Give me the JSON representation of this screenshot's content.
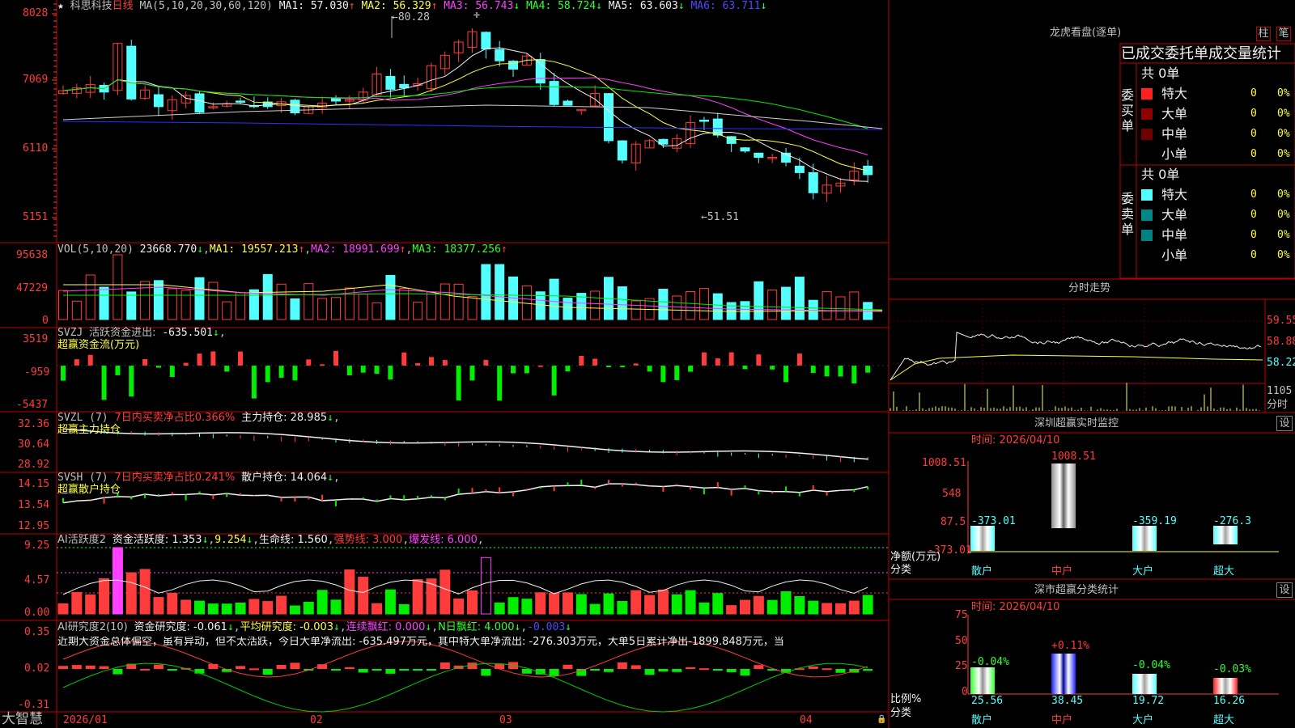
{
  "stock": {
    "name": "科思科技",
    "period": "日线",
    "ma_params": "MA(5,10,20,30,60,120)",
    "ma1": "MA1: 57.030",
    "ma2": "MA2: 56.329",
    "ma3": "MA3: 56.743",
    "ma4": "MA4: 58.724",
    "ma5": "MA5: 63.603",
    "ma6": "MA6: 63.711",
    "arrow_up": "↑",
    "arrow_down": "↓",
    "star": "★",
    "plus": "✛",
    "high_label": "80.28",
    "low_label": "51.51",
    "high_arrow": "←",
    "low_arrow": "←"
  },
  "price_axis": [
    "8028",
    "7069",
    "6110",
    "5151"
  ],
  "vol": {
    "title": "VOL(5,10,20)",
    "value": "23668.770",
    "ma1": "MA1: 19557.213",
    "ma2": "MA2: 18991.699",
    "ma3": "MA3: 18377.256",
    "axis": [
      "95638",
      "47229",
      "0"
    ]
  },
  "svzj": {
    "title": "SVZJ",
    "label": "活跃资金进出:",
    "value": "-635.501",
    "sub": "超赢资金流(万元)",
    "axis": [
      "3519",
      "-959",
      "-5437"
    ]
  },
  "svzl": {
    "title": "SVZL (7)",
    "label": "7日内买卖净占比0.366%",
    "hold": "主力持仓: 28.985",
    "sub": "超赢主力持仓",
    "axis": [
      "32.36",
      "30.64",
      "28.92"
    ]
  },
  "svsh": {
    "title": "SVSH (7)",
    "label": "7日内买卖净占比0.241%",
    "hold": "散户持仓: 14.064",
    "sub": "超赢散户持仓",
    "axis": [
      "14.15",
      "13.54",
      "12.95"
    ]
  },
  "ai1": {
    "title": "AI活跃度2",
    "label": "资金活跃度: 1.353",
    "v2": "9.254",
    "life": "生命线: 1.560",
    "strong": "强势线: 3.000",
    "burst": "爆发线: 6.000",
    "axis": [
      "9.25",
      "4.57",
      "0.00"
    ]
  },
  "ai2": {
    "title": "AI研究度2(10)",
    "label": "资金研究度: -0.061",
    "avg": "平均研究度: -0.003",
    "lx": "连续飘红: 0.000",
    "nd": "N日飘红: 4.000",
    "last": "-0.003",
    "axis": [
      "0.35",
      "0.02",
      "-0.31"
    ],
    "comment": "近期大资金总体偏空，虽有异动，但不太活跃，今日大单净流出: -635.497万元，其中特大单净流出: -276.303万元，大单5日累计净出-1899.848万元，当"
  },
  "bottom": {
    "brand": "大智慧",
    "dates": [
      "2026/01",
      "02",
      "03",
      "04"
    ],
    "lock": "🔒"
  },
  "dragon": {
    "title": "龙虎看盘(逐单)",
    "btn1": "柱",
    "btn2": "笔",
    "tabs": "已成交委托单成交量统计",
    "buy_label": "委买单",
    "sell_label": "委卖单",
    "buy_total": "共 0单",
    "sell_total": "共 0单",
    "rows": [
      {
        "name": "特大",
        "count": "0",
        "pct": "0%"
      },
      {
        "name": "大单",
        "count": "0",
        "pct": "0%"
      },
      {
        "name": "中单",
        "count": "0",
        "pct": "0%"
      },
      {
        "name": "小单",
        "count": "0",
        "pct": "0%"
      }
    ]
  },
  "intraday": {
    "title": "分时走势",
    "axis": [
      "59.55",
      "58.88",
      "58.22"
    ],
    "vol_axis": "1105",
    "vol_label": "分时"
  },
  "sz_monitor": {
    "title": "深圳超赢实时监控",
    "set": "设",
    "date": "时间: 2026/04/10",
    "axis": [
      "1008.51",
      "548",
      "87.5",
      "-373.01"
    ],
    "side": "净额(万元)",
    "side2": "分类",
    "categories": [
      "散户",
      "中户",
      "大户",
      "超大"
    ],
    "values": [
      "-373.01",
      "1008.51",
      "-359.19",
      "-276.3"
    ]
  },
  "sz_class": {
    "title": "深市超赢分类统计",
    "set": "设",
    "date": "时间: 2026/04/10",
    "axis": [
      "75",
      "50",
      "25",
      "0"
    ],
    "side": "比例%",
    "side2": "分类",
    "categories": [
      "散户",
      "中户",
      "大户",
      "超大"
    ],
    "pct_top": [
      "-0.04%",
      "+0.11%",
      "-0.04%",
      "-0.03%"
    ],
    "pct_bottom": [
      "25.56",
      "38.45",
      "19.72",
      "16.26"
    ]
  },
  "colors": {
    "red": "#ff3c3c",
    "cyan": "#54ffff",
    "green": "#00ee00",
    "yellow": "#ffff40",
    "magenta": "#ff40ff",
    "blue": "#3030ff",
    "frame": "#c00000"
  }
}
